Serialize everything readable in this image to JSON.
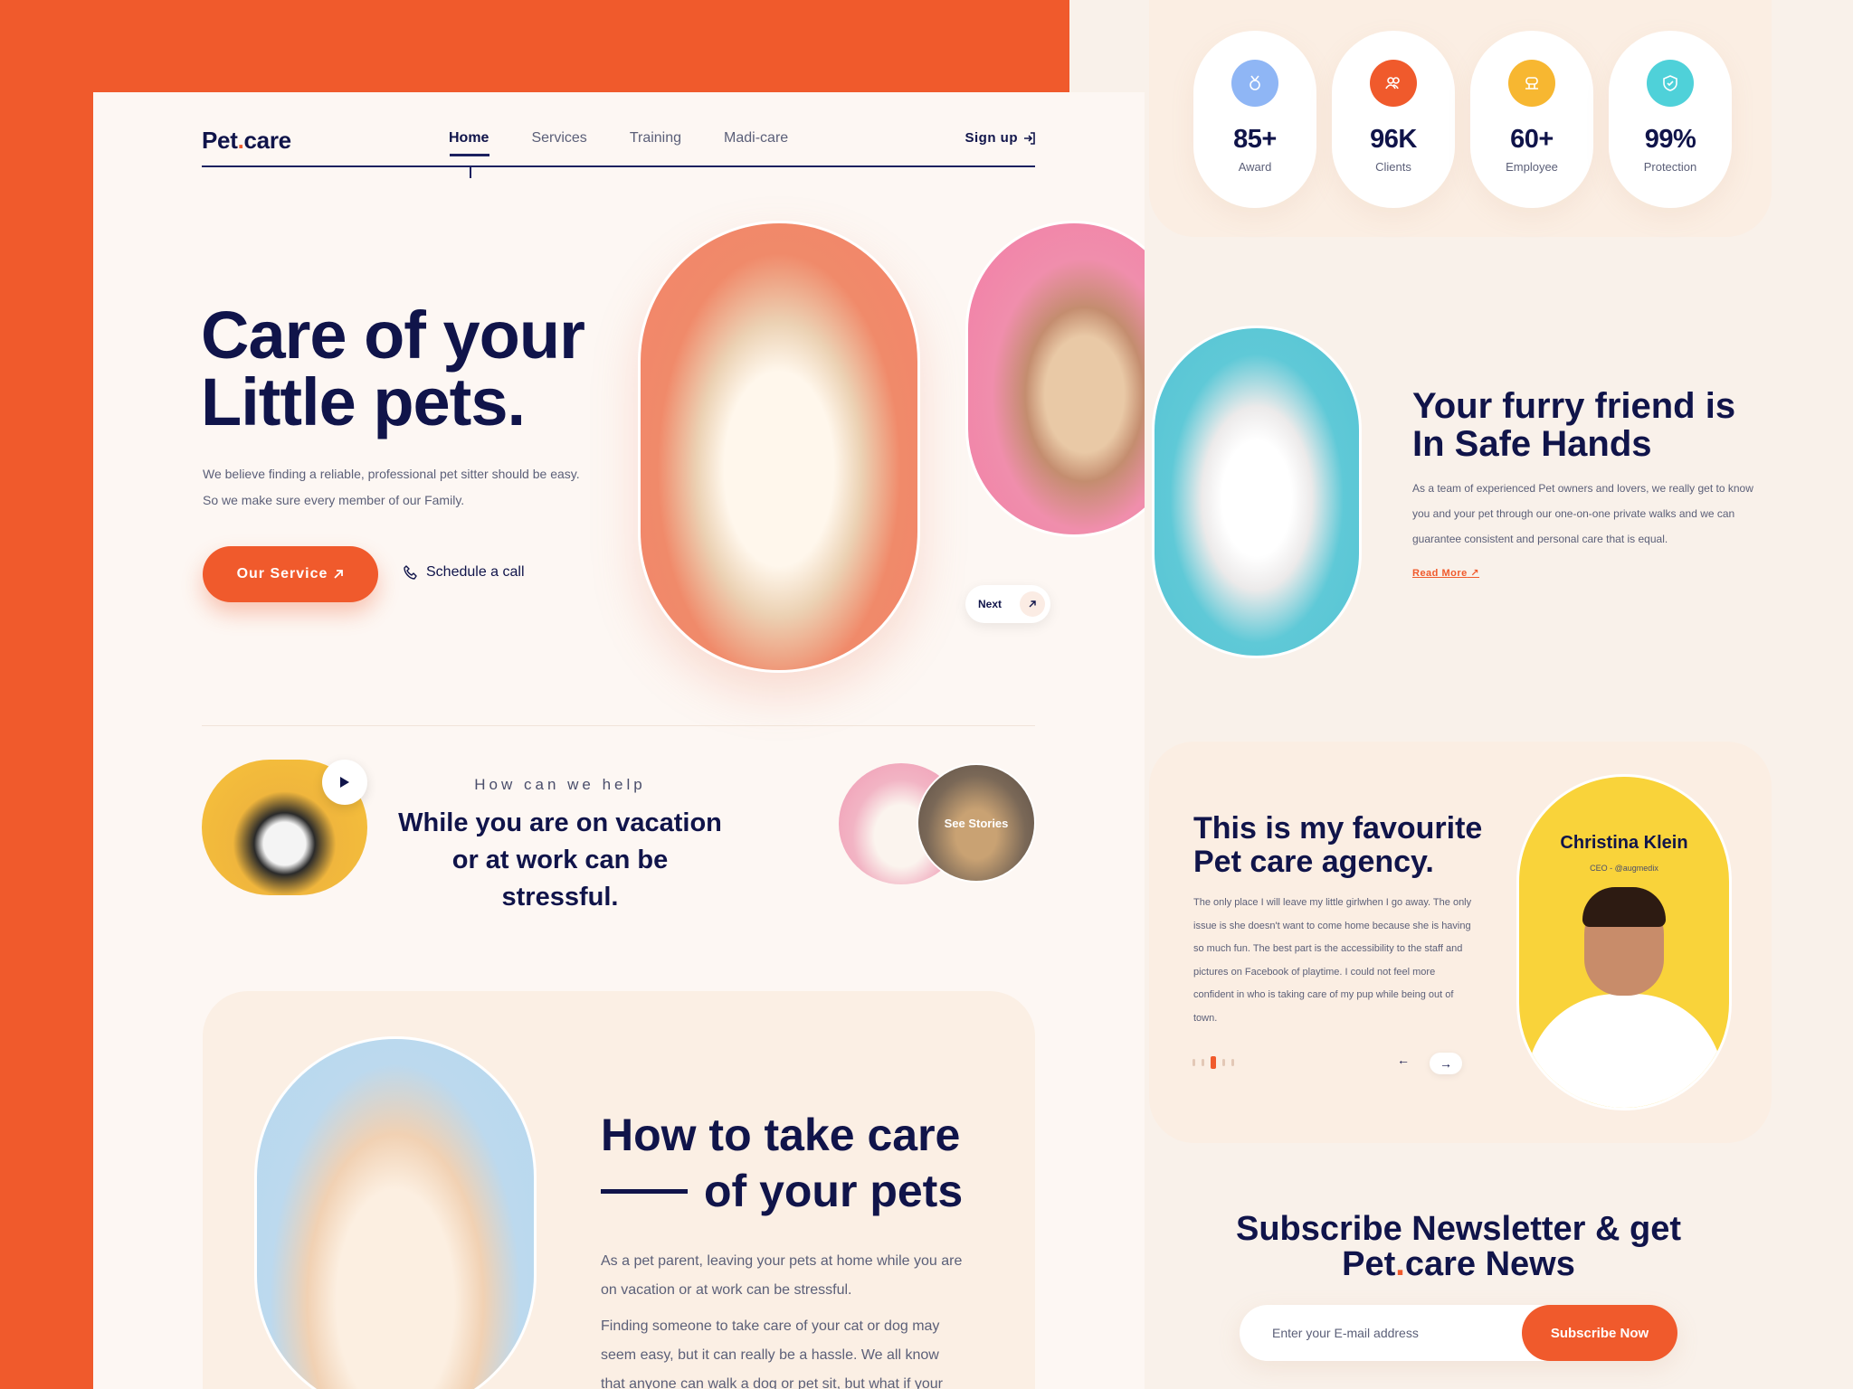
{
  "brand": {
    "logo_left": "Pet",
    "logo_dot": ".",
    "logo_right": "care"
  },
  "nav": {
    "items": [
      {
        "label": "Home",
        "active": true
      },
      {
        "label": "Services"
      },
      {
        "label": "Training"
      },
      {
        "label": "Madi-care"
      }
    ],
    "signup_label": "Sign up"
  },
  "hero": {
    "title_line1": "Care of your",
    "title_line2": "Little pets.",
    "text": "We believe finding a reliable, professional pet sitter should be easy. So we make sure every member of our Family.",
    "primary_button": "Our Service",
    "call_button": "Schedule a call",
    "next_label": "Next"
  },
  "help": {
    "label": "How can we help",
    "title": "While you are on vacation or at work can be stressful.",
    "stories_label": "See Stories"
  },
  "care": {
    "title_line1": "How to take care",
    "title_line2": "of your pets",
    "paragraph1": "As a pet parent, leaving your pets at home while you are on vacation or at work can be stressful.",
    "paragraph2": "Finding someone to take care of your cat or dog may seem easy, but it can really be a hassle. We all know that anyone can walk a dog or pet sit, but what if your"
  },
  "stats": [
    {
      "value": "85+",
      "label": "Award",
      "icon": "medal-icon",
      "color": "#8fb6f5"
    },
    {
      "value": "96K",
      "label": "Clients",
      "icon": "users-icon",
      "color": "#f05a2c"
    },
    {
      "value": "60+",
      "label": "Employee",
      "icon": "employee-icon",
      "color": "#f7b731"
    },
    {
      "value": "99%",
      "label": "Protection",
      "icon": "shield-icon",
      "color": "#4fd1d9"
    }
  ],
  "furry": {
    "title": "Your furry friend is In Safe Hands",
    "text": "As a team of experienced Pet owners and lovers, we really get to know you and your pet through our one-on-one private walks and we can guarantee consistent and personal care that is equal.",
    "read_more": "Read More"
  },
  "testimonial": {
    "title": "This is my favourite Pet care agency.",
    "text": "The only place I will leave my little girlwhen I go away. The only issue is she doesn't want to come home because she is having so much fun. The best part is the accessibility to the staff and pictures on Facebook of playtime. I could not feel more confident in who is taking care of my pup while being out of town.",
    "name": "Christina Klein",
    "role": "CEO - @augmedix",
    "prev": "←",
    "next": "→"
  },
  "newsletter": {
    "title_line1": "Subscribe Newsletter & get",
    "title_brand_left": "Pet",
    "title_brand_dot": ".",
    "title_brand_right": "care News",
    "placeholder": "Enter your E-mail address",
    "button": "Subscribe Now"
  },
  "colors": {
    "accent": "#f05a2c",
    "navy": "#10144a",
    "cream": "#fdf7f3"
  }
}
